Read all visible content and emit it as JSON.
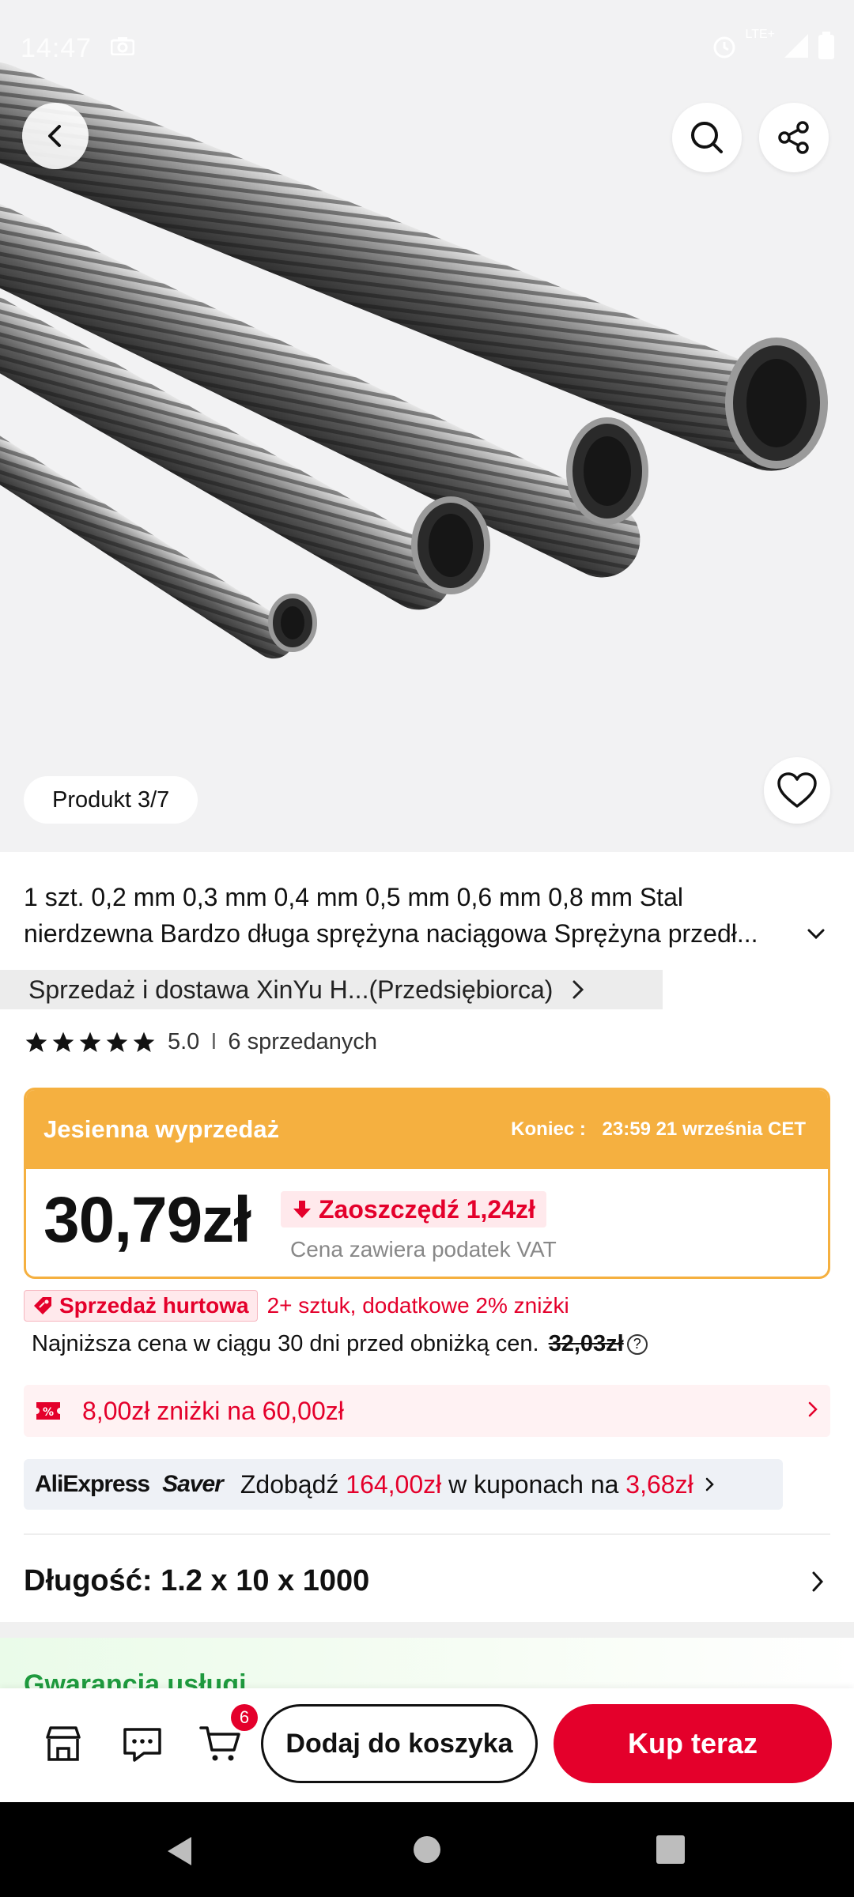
{
  "status_bar": {
    "time": "14:47",
    "network": "LTE+"
  },
  "hero": {
    "counter_label": "Produkt 3/7"
  },
  "product": {
    "title_line1": "1 szt. 0,2 mm 0,3 mm 0,4 mm 0,5 mm 0,6 mm 0,8 mm Stal",
    "title_line2": "nierdzewna Bardzo długa sprężyna naciągowa Sprężyna przedł...",
    "seller_label": "Sprzedaż i dostawa XinYu H...(Przedsiębiorca)",
    "rating": "5.0",
    "rating_stars": 5,
    "sold_count": "6 sprzedanych"
  },
  "sale": {
    "name": "Jesienna wyprzedaż",
    "ends_label": "Koniec :",
    "ends_value": "23:59 21 września CET",
    "price": "30,79zł",
    "save_badge": "Zaoszczędź 1,24zł",
    "vat_note": "Cena zawiera podatek VAT"
  },
  "bulk": {
    "tag": "Sprzedaż hurtowa",
    "text": "2+ sztuk, dodatkowe 2% zniżki"
  },
  "lowest_price": {
    "text": "Najniższa cena w ciągu 30 dni przed obniżką cen.",
    "old_price": "32,03zł"
  },
  "coupon": {
    "text": "8,00zł zniżki na 60,00zł"
  },
  "saver": {
    "logo_ae": "AliExpress",
    "logo_saver": "Saver",
    "msg_prefix": "Zdobądź",
    "coupon_value": "164,00zł",
    "msg_middle": "w kuponach na",
    "price_value": "3,68zł"
  },
  "variant": {
    "label": "Długość: 1.2 x 10 x 1000"
  },
  "guarantee": {
    "title": "Gwarancja usługi"
  },
  "bottom_bar": {
    "cart_count": "6",
    "add_to_cart": "Dodaj do koszyka",
    "buy_now": "Kup teraz"
  },
  "colors": {
    "accent_red": "#e4002b",
    "sale_orange": "#f5b040",
    "guarantee_green": "#1e9a3e"
  }
}
